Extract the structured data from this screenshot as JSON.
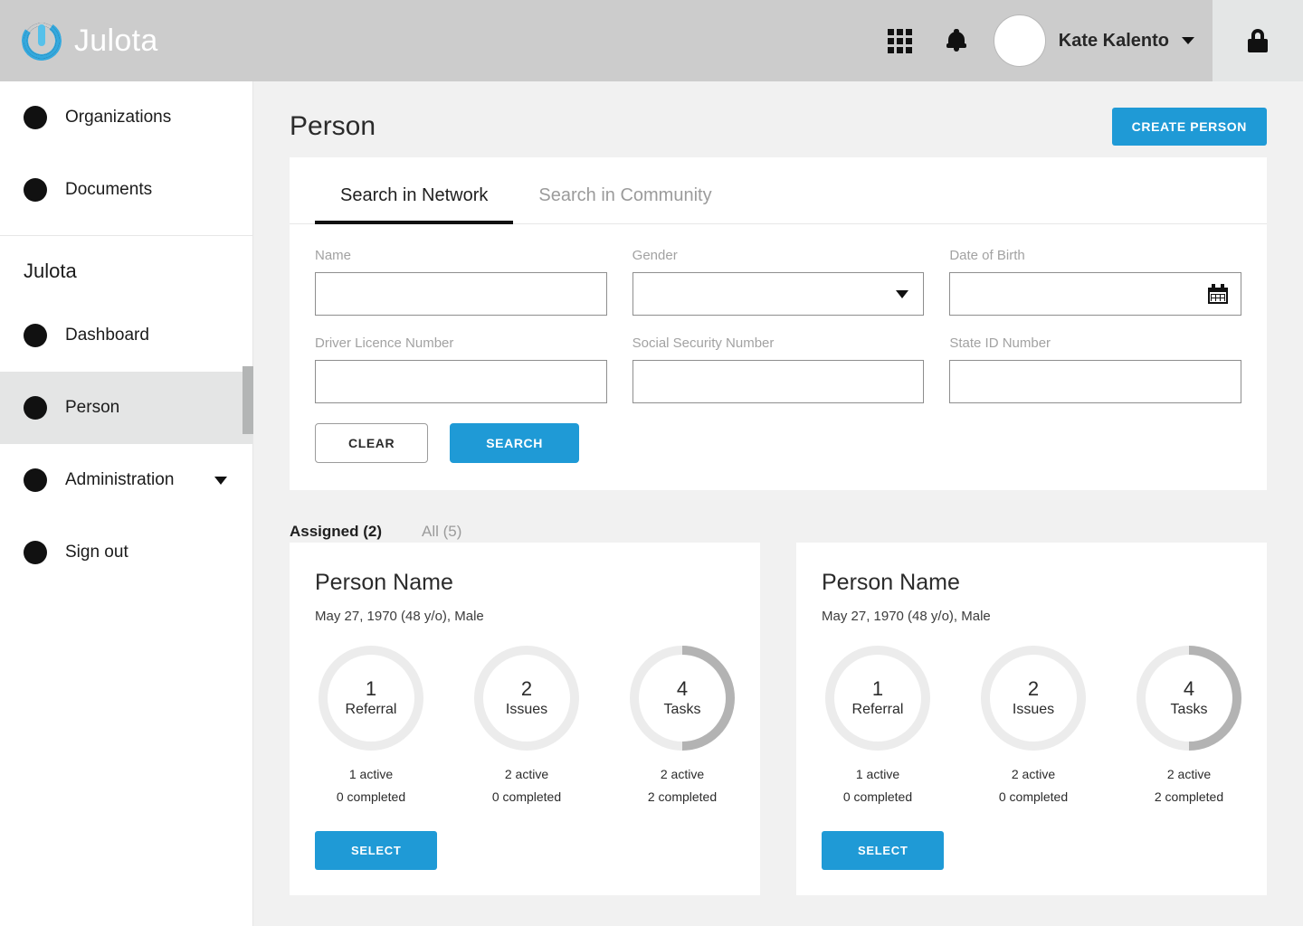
{
  "topbar": {
    "brand": "Julota",
    "icons": {
      "grid": "grid-icon",
      "bell": "bell-icon",
      "lock": "lock-icon"
    },
    "user_name": "Kate Kalento",
    "accent_color": "#1f9ad6",
    "background_color": "#cccccc"
  },
  "sidebar": {
    "top_items": [
      {
        "label": "Organizations"
      },
      {
        "label": "Documents"
      }
    ],
    "section_title": "Julota",
    "items": [
      {
        "label": "Dashboard",
        "active": false,
        "has_caret": false
      },
      {
        "label": "Person",
        "active": true,
        "has_caret": false
      },
      {
        "label": "Administration",
        "active": false,
        "has_caret": true
      },
      {
        "label": "Sign out",
        "active": false,
        "has_caret": false
      }
    ]
  },
  "page": {
    "title": "Person",
    "create_button": "CREATE PERSON"
  },
  "search_panel": {
    "tabs": [
      {
        "label": "Search in Network",
        "active": true
      },
      {
        "label": "Search in Community",
        "active": false
      }
    ],
    "fields": [
      {
        "label": "Name",
        "value": "",
        "placeholder": "",
        "type": "text"
      },
      {
        "label": "Gender",
        "value": "",
        "placeholder": "",
        "type": "select"
      },
      {
        "label": "Date of Birth",
        "value": "",
        "placeholder": "",
        "type": "date"
      },
      {
        "label": "Driver Licence Number",
        "value": "",
        "placeholder": "",
        "type": "text"
      },
      {
        "label": "Social Security Number",
        "value": "",
        "placeholder": "",
        "type": "text"
      },
      {
        "label": "State ID Number",
        "value": "",
        "placeholder": "",
        "type": "text"
      }
    ],
    "clear_button": "CLEAR",
    "search_button": "SEARCH"
  },
  "results": {
    "tabs": [
      {
        "label": "Assigned (2)",
        "active": true
      },
      {
        "label": "All (5)",
        "active": false
      }
    ],
    "cards": [
      {
        "name": "Person Name",
        "details": "May 27, 1970 (48 y/o), Male",
        "rings": [
          {
            "count": "1",
            "label": "Referral",
            "active": "1 active",
            "completed": "0 completed",
            "progress_pct": 0
          },
          {
            "count": "2",
            "label": "Issues",
            "active": "2 active",
            "completed": "0 completed",
            "progress_pct": 0
          },
          {
            "count": "4",
            "label": "Tasks",
            "active": "2 active",
            "completed": "2 completed",
            "progress_pct": 50
          }
        ],
        "select_button": "SELECT"
      },
      {
        "name": "Person Name",
        "details": "May 27, 1970 (48 y/o), Male",
        "rings": [
          {
            "count": "1",
            "label": "Referral",
            "active": "1 active",
            "completed": "0 completed",
            "progress_pct": 0
          },
          {
            "count": "2",
            "label": "Issues",
            "active": "2 active",
            "completed": "0 completed",
            "progress_pct": 0
          },
          {
            "count": "4",
            "label": "Tasks",
            "active": "2 active",
            "completed": "2 completed",
            "progress_pct": 50
          }
        ],
        "select_button": "SELECT"
      }
    ]
  },
  "colors": {
    "accent": "#1f9ad6",
    "ring_track": "#ececec",
    "ring_progress": "#b3b3b3",
    "page_bg": "#f1f1f1"
  }
}
